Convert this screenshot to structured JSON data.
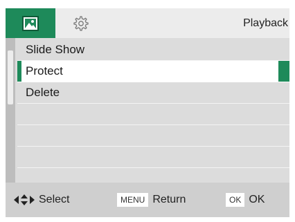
{
  "header": {
    "title": "Playback",
    "tabs": [
      {
        "icon": "image-icon",
        "active": true
      },
      {
        "icon": "gear-icon",
        "active": false
      }
    ]
  },
  "menu": {
    "items": [
      {
        "label": "Slide Show",
        "selected": false
      },
      {
        "label": "Protect",
        "selected": true
      },
      {
        "label": "Delete",
        "selected": false
      },
      {
        "label": "",
        "selected": false
      },
      {
        "label": "",
        "selected": false
      },
      {
        "label": "",
        "selected": false
      }
    ]
  },
  "footer": {
    "select_label": "Select",
    "menu_key": "MENU",
    "return_label": "Return",
    "ok_key": "OK",
    "ok_label": "OK"
  },
  "colors": {
    "accent": "#1e8a5a",
    "background": "#dcdcdc",
    "topbar": "#ececec",
    "footer": "#cfcfcf"
  }
}
